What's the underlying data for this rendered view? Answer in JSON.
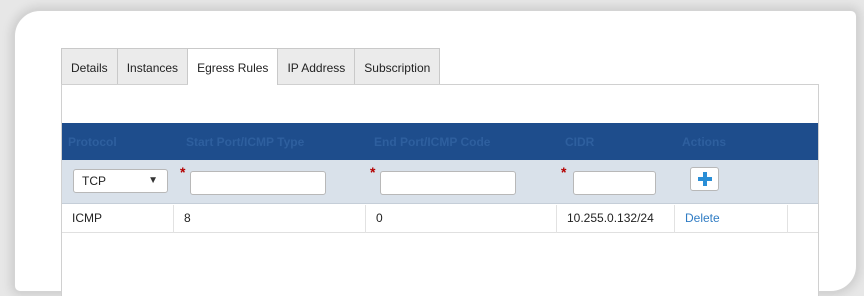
{
  "tabs": [
    {
      "label": "Details",
      "active": false
    },
    {
      "label": "Instances",
      "active": false
    },
    {
      "label": "Egress Rules",
      "active": true
    },
    {
      "label": "IP Address",
      "active": false
    },
    {
      "label": "Subscription",
      "active": false
    }
  ],
  "table": {
    "headers": [
      "Protocol",
      "Start Port/ICMP Type",
      "End Port/ICMP Code",
      "CIDR",
      "Actions"
    ],
    "add_row": {
      "protocol_selected": "TCP",
      "required_marker": "*",
      "start_port_value": "",
      "end_port_value": "",
      "cidr_value": "",
      "add_icon": "plus-icon"
    },
    "rows": [
      {
        "protocol": "ICMP",
        "start": "8",
        "end": "0",
        "cidr": "10.255.0.132/24",
        "action": "Delete"
      }
    ]
  },
  "colors": {
    "header_bg": "#1e4d8c",
    "header_text": "#2e5f9e",
    "add_row_bg": "#d9e1ea",
    "link": "#2f7cc4",
    "required": "#b40000"
  }
}
